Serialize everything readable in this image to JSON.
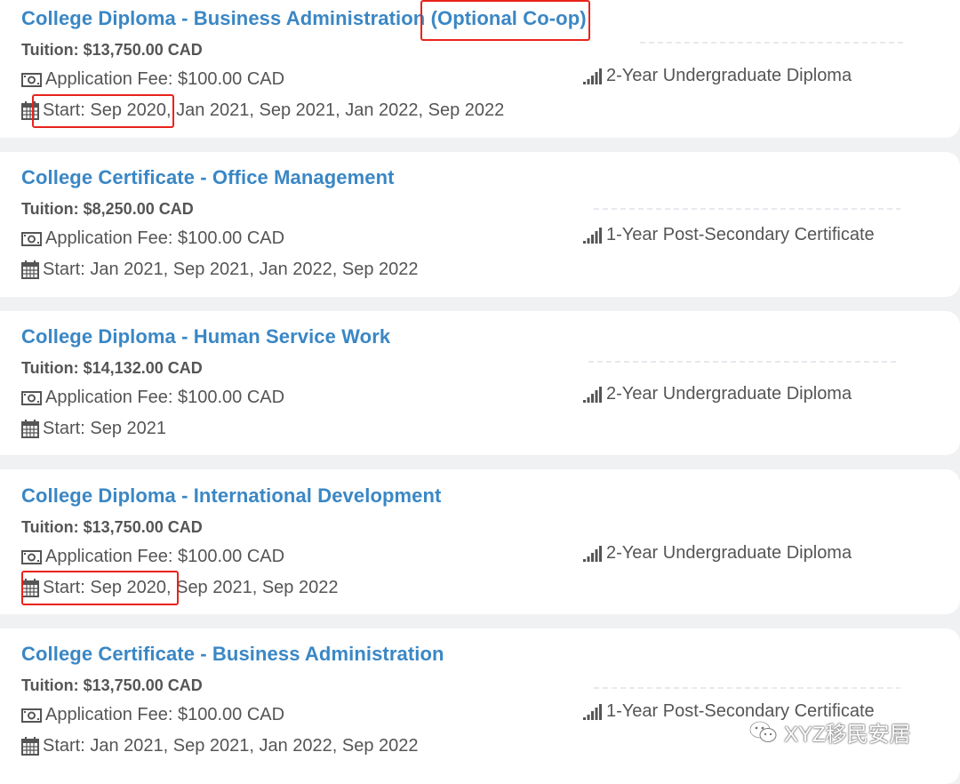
{
  "programs": [
    {
      "title": "College Diploma - Business Administration",
      "title_suffix": " (Optional Co-op)",
      "tuition": "Tuition: $13,750.00 CAD",
      "fee": "Application Fee: $100.00 CAD",
      "start": "Start: Sep 2020, Jan 2021, Sep 2021, Jan 2022, Sep 2022",
      "level": "2-Year Undergraduate Diploma"
    },
    {
      "title": "College Certificate - Office Management",
      "title_suffix": "",
      "tuition": "Tuition: $8,250.00 CAD",
      "fee": "Application Fee: $100.00 CAD",
      "start": "Start: Jan 2021, Sep 2021, Jan 2022, Sep 2022",
      "level": "1-Year Post-Secondary Certificate"
    },
    {
      "title": "College Diploma - Human Service Work",
      "title_suffix": "",
      "tuition": "Tuition: $14,132.00 CAD",
      "fee": "Application Fee: $100.00 CAD",
      "start": "Start: Sep 2021",
      "level": "2-Year Undergraduate Diploma"
    },
    {
      "title": "College Diploma - International Development",
      "title_suffix": "",
      "tuition": "Tuition: $13,750.00 CAD",
      "fee": "Application Fee: $100.00 CAD",
      "start": "Start: Sep 2020, Sep 2021, Sep 2022",
      "level": "2-Year Undergraduate Diploma"
    },
    {
      "title": "College Certificate - Business Administration",
      "title_suffix": "",
      "tuition": "Tuition: $13,750.00 CAD",
      "fee": "Application Fee: $100.00 CAD",
      "start": "Start: Jan 2021, Sep 2021, Jan 2022, Sep 2022",
      "level": "1-Year Post-Secondary Certificate"
    }
  ],
  "watermark": "XYZ移民安居",
  "icons": {
    "fee": "money-icon",
    "start": "calendar-icon",
    "level": "signal-bars-icon"
  },
  "colors": {
    "link": "#3a87c5",
    "text": "#555555",
    "highlight": "#e8231c",
    "background": "#f0f1f3"
  }
}
